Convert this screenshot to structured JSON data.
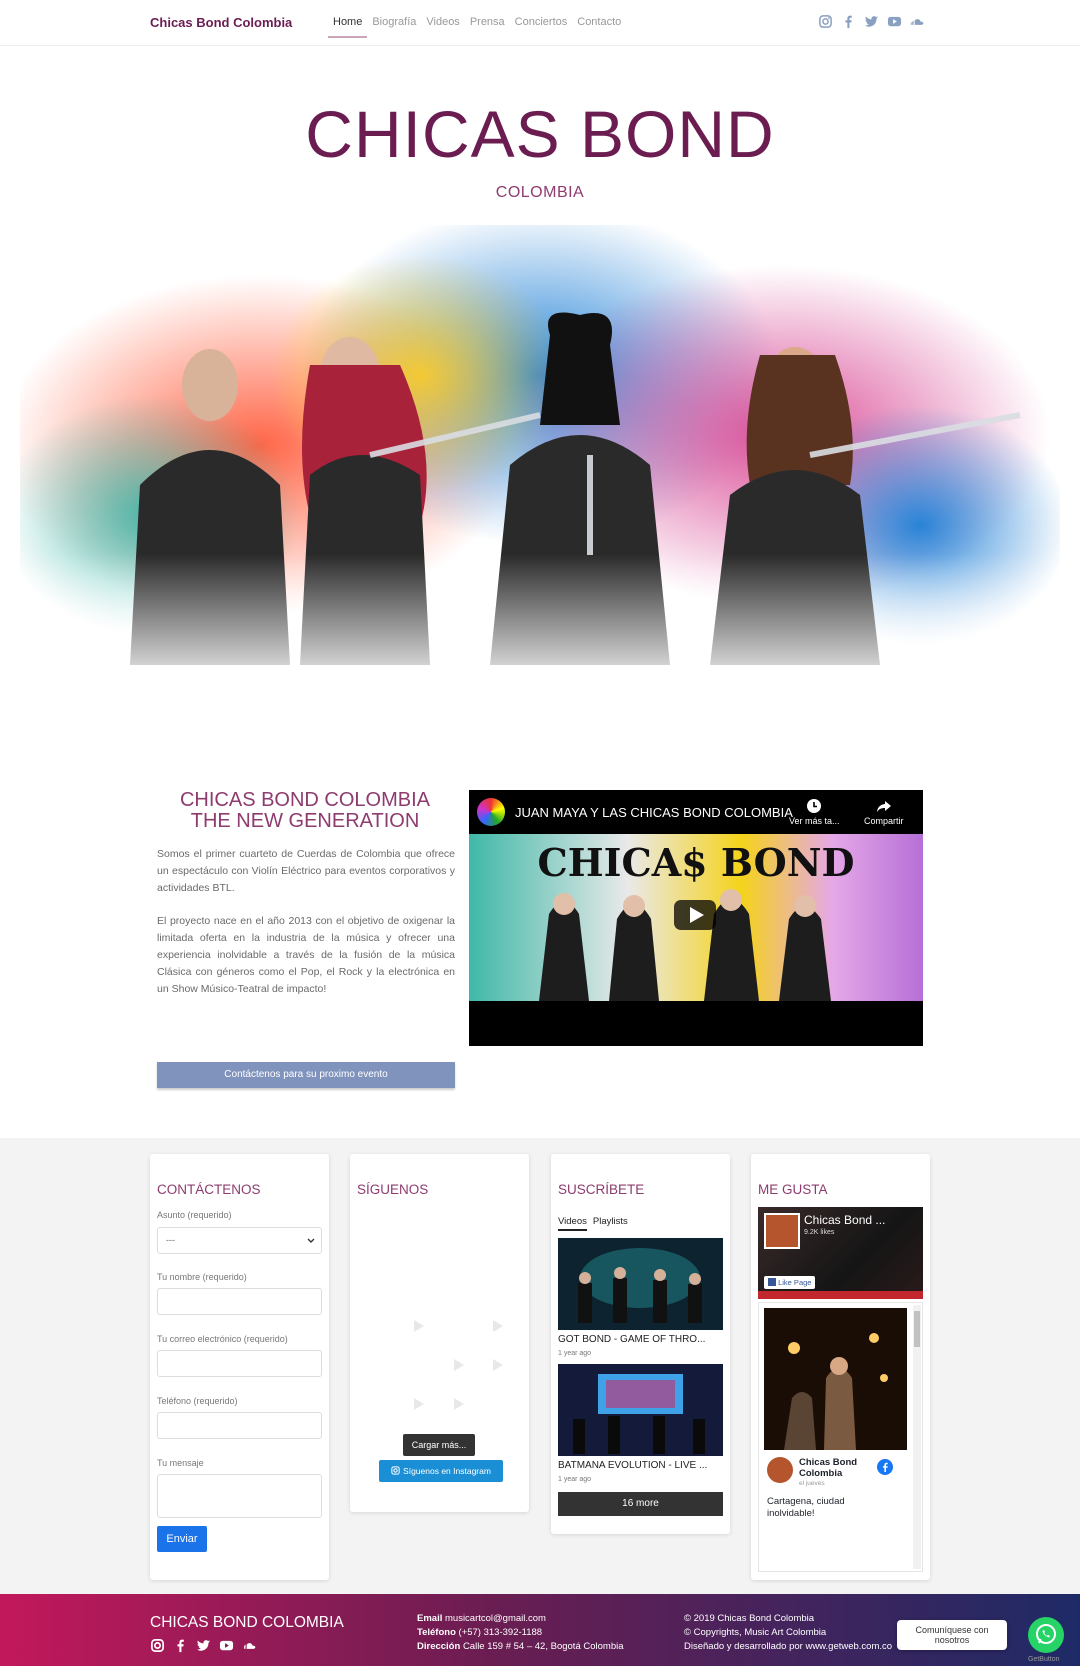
{
  "nav": {
    "brand": "Chicas Bond Colombia",
    "items": [
      {
        "label": "Home",
        "active": true
      },
      {
        "label": "Biografía",
        "active": false
      },
      {
        "label": "Videos",
        "active": false
      },
      {
        "label": "Prensa",
        "active": false
      },
      {
        "label": "Conciertos",
        "active": false
      },
      {
        "label": "Contacto",
        "active": false
      }
    ],
    "social_icons": [
      "instagram-icon",
      "facebook-icon",
      "twitter-icon",
      "youtube-icon",
      "soundcloud-icon"
    ],
    "icon_color": "#8aa0c0"
  },
  "hero": {
    "title": "CHICAS BOND",
    "subtitle": "COLOMBIA"
  },
  "about": {
    "title_line1": "CHICAS BOND COLOMBIA",
    "title_line2": "THE NEW GENERATION",
    "paragraph1": "Somos el primer cuarteto de Cuerdas de Colombia que ofrece un espectáculo con Violín Eléctrico para eventos corporativos y actividades BTL.",
    "paragraph2": "El proyecto nace en el año 2013 con el objetivo de oxigenar la limitada oferta en la industria de la música y ofrecer una experiencia inolvidable a través de la fusión de la música Clásica con géneros como el Pop, el Rock y la electrónica en un Show Músico-Teatral de impacto!",
    "cta_label": "Contáctenos para su proximo evento"
  },
  "video": {
    "title": "JUAN MAYA Y LAS CHICAS BOND COLOMBIA",
    "watch_later": "Ver más ta...",
    "share": "Compartir",
    "thumb_text": "CHICA$ BOND"
  },
  "contact": {
    "heading": "CONTÁCTENOS",
    "subject_label": "Asunto (requerido)",
    "subject_value": "---",
    "name_label": "Tu nombre (requerido)",
    "email_label": "Tu correo electrónico (requerido)",
    "phone_label": "Teléfono (requerido)",
    "message_label": "Tu mensaje",
    "send_label": "Enviar"
  },
  "follow": {
    "heading": "SÍGUENOS",
    "load_more": "Cargar más...",
    "follow_instagram": "Síguenos en Instagram"
  },
  "subscribe": {
    "heading": "SUSCRÍBETE",
    "tabs": [
      "Videos",
      "Playlists"
    ],
    "videos": [
      {
        "title": "GOT BOND - GAME OF THRO...",
        "meta": "1 year ago"
      },
      {
        "title": "BATMANA EVOLUTION - LIVE ...",
        "meta": "1 year ago"
      }
    ],
    "more_label": "16 more"
  },
  "like": {
    "heading": "ME GUSTA",
    "page_name": "Chicas Bond ...",
    "likes": "9.2K likes",
    "like_button": "Like Page",
    "post_author": "Chicas Bond Colombia",
    "post_time": "el jueves",
    "post_text": "Cartagena, ciudad inolvidable!"
  },
  "footer": {
    "brand": "CHICAS BOND COLOMBIA",
    "email_label": "Email",
    "email": "musicartcol@gmail.com",
    "phone_label": "Teléfono",
    "phone": "(+57) 313-392-1188",
    "address_label": "Dirección",
    "address": "Calle 159 # 54 – 42, Bogotá Colombia",
    "copyright1": "© 2019 Chicas Bond Colombia",
    "copyright2": "© Copyrights, Music Art Colombia",
    "credit": "Diseñado y desarrollado por www.getweb.com.co"
  },
  "chat": {
    "label": "Comuníquese con nosotros",
    "widget_name": "GetButton"
  }
}
